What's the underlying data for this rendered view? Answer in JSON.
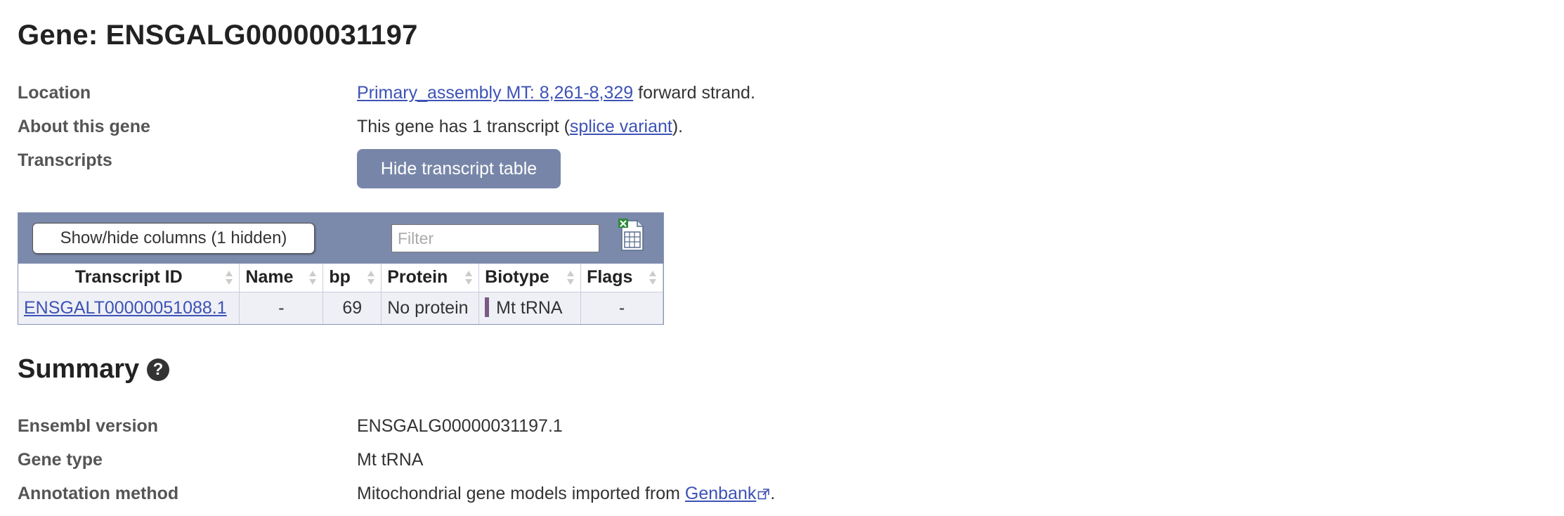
{
  "page": {
    "title": "Gene: ENSGALG00000031197"
  },
  "gene_info": {
    "location_label": "Location",
    "location_link": "Primary_assembly MT: 8,261-8,329",
    "location_suffix": " forward strand.",
    "about_label": "About this gene",
    "about_prefix": "This gene has 1 transcript (",
    "about_link": "splice variant",
    "about_suffix": ").",
    "transcripts_label": "Transcripts",
    "hide_button": "Hide transcript table"
  },
  "transcript_table": {
    "columns_button": "Show/hide columns (1 hidden)",
    "filter_placeholder": "Filter",
    "export_icon": "spreadsheet-export-icon",
    "headers": [
      "Transcript ID",
      "Name",
      "bp",
      "Protein",
      "Biotype",
      "Flags"
    ],
    "rows": [
      {
        "transcript_id": "ENSGALT00000051088.1",
        "name": "-",
        "bp": "69",
        "protein": "No protein",
        "biotype": "Mt tRNA",
        "biotype_color": "#7a5a84",
        "flags": "-"
      }
    ]
  },
  "summary": {
    "title": "Summary",
    "help_icon": "?",
    "version_label": "Ensembl version",
    "version_value": "ENSGALG00000031197.1",
    "gene_type_label": "Gene type",
    "gene_type_value": "Mt tRNA",
    "annotation_label": "Annotation method",
    "annotation_prefix": "Mitochondrial gene models imported from ",
    "annotation_link": "Genbank",
    "annotation_suffix": "."
  },
  "colors": {
    "link": "#3d52b5",
    "button": "#7786a8",
    "table_header_bar": "#7b89ab",
    "table_row": "#eef0f6"
  }
}
